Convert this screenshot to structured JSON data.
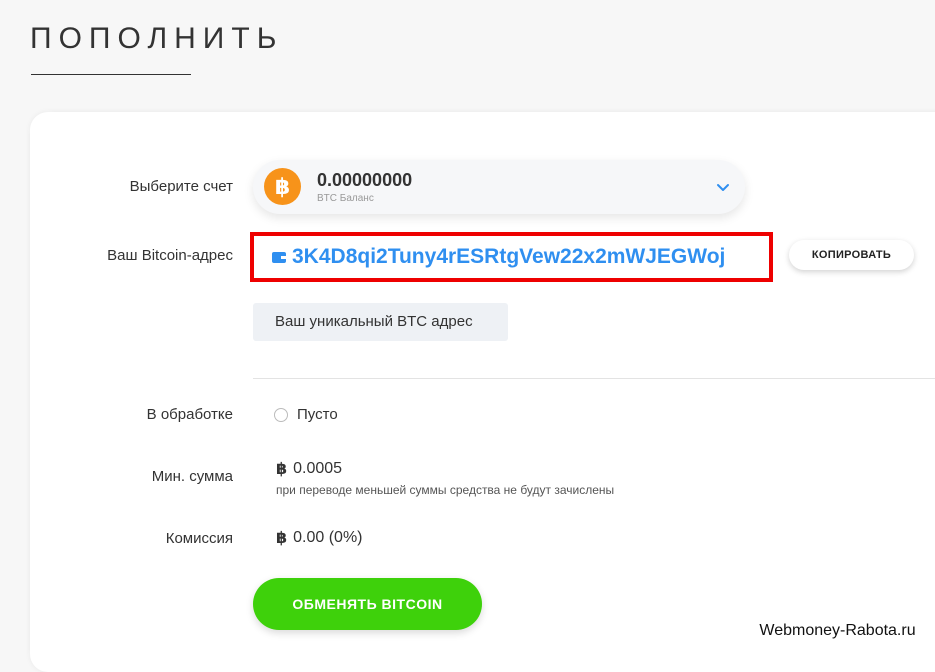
{
  "page": {
    "title": "ПОПОЛНИТЬ"
  },
  "account": {
    "label": "Выберите счет",
    "amount": "0.00000000",
    "currency_caption": "BTC Баланс",
    "icon": "bitcoin-icon",
    "icon_glyph": "฿",
    "icon_color": "#f7931a"
  },
  "address": {
    "label": "Ваш Bitcoin-адрес",
    "value": "3K4D8qi2Tuny4rESRtgVew22x2mWJEGWoj",
    "copy_label": "КОПИРОВАТЬ",
    "hint": "Ваш уникальный BTC адрес",
    "highlight_color": "#ee0000",
    "text_color": "#2f8ff0"
  },
  "processing": {
    "label": "В обработке",
    "value": "Пусто"
  },
  "min_amount": {
    "label": "Мин. сумма",
    "symbol": "฿",
    "value": "0.0005",
    "note": "при переводе меньшей суммы средства не будут зачислены"
  },
  "commission": {
    "label": "Комиссия",
    "symbol": "฿",
    "value": "0.00 (0%)"
  },
  "action": {
    "exchange_label": "ОБМЕНЯТЬ BITCOIN",
    "color": "#3ed10b"
  },
  "watermark": {
    "text": "Webmoney-Rabota.ru"
  }
}
